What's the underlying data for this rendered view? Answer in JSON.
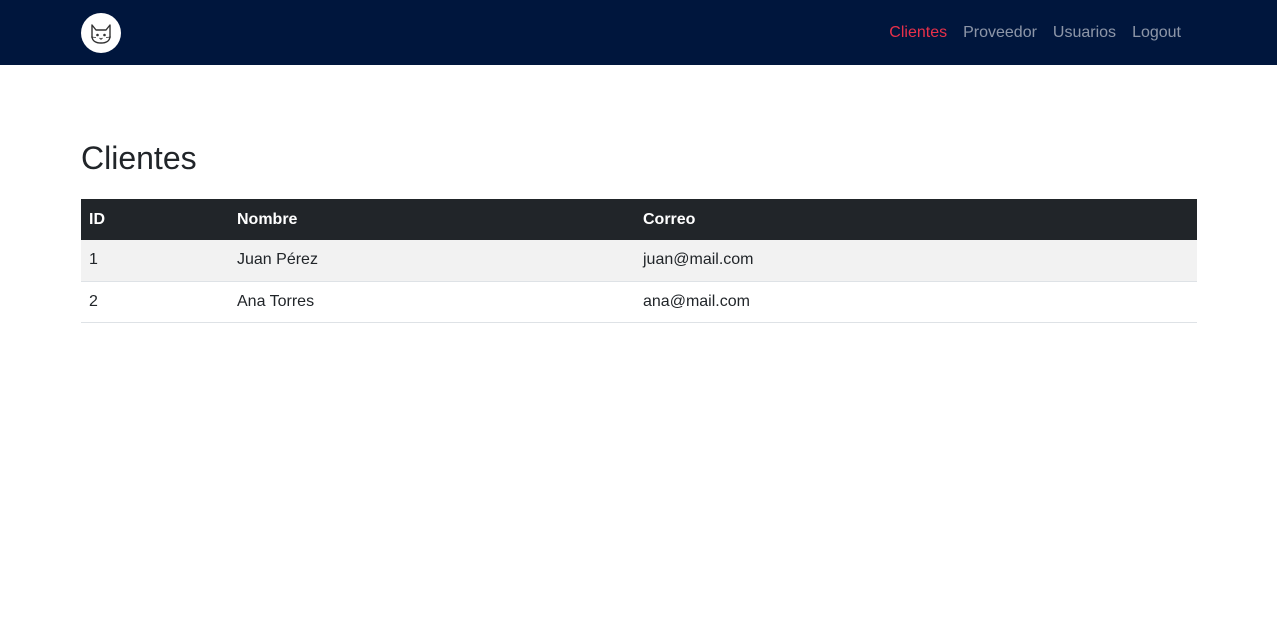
{
  "nav": {
    "logo_icon": "cat-icon",
    "links": [
      {
        "label": "Clientes",
        "active": true
      },
      {
        "label": "Proveedor",
        "active": false
      },
      {
        "label": "Usuarios",
        "active": false
      },
      {
        "label": "Logout",
        "active": false
      }
    ],
    "active_color": "#e8304a",
    "background": "#00163d"
  },
  "page": {
    "title": "Clientes"
  },
  "table": {
    "headers": [
      "ID",
      "Nombre",
      "Correo"
    ],
    "rows": [
      {
        "id": "1",
        "nombre": "Juan Pérez",
        "correo": "juan@mail.com"
      },
      {
        "id": "2",
        "nombre": "Ana Torres",
        "correo": "ana@mail.com"
      }
    ]
  }
}
